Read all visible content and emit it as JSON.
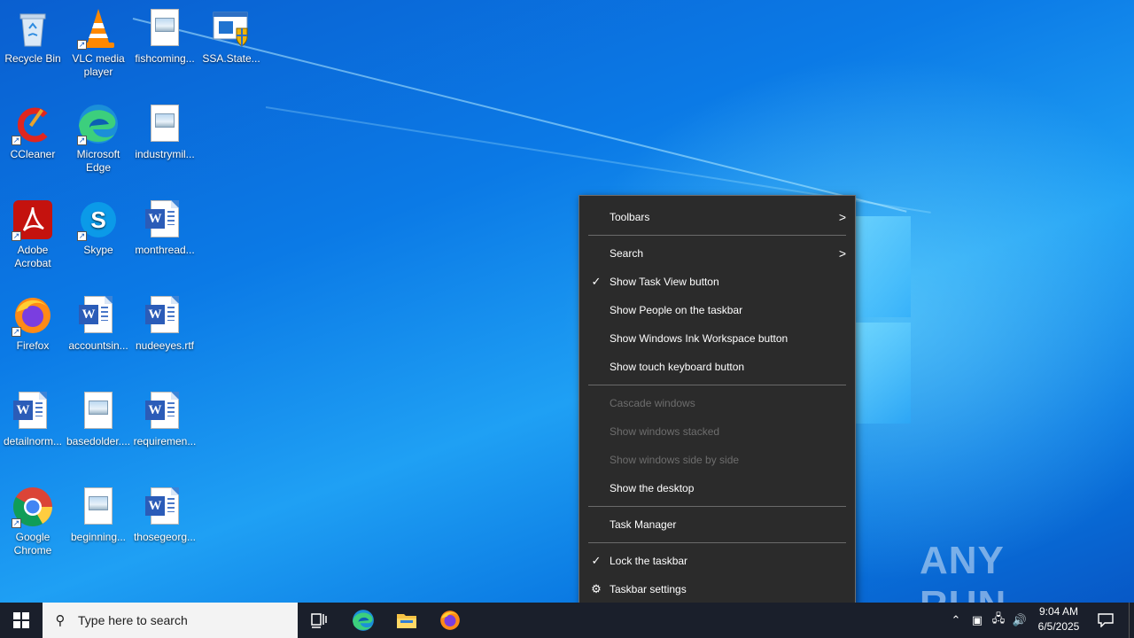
{
  "desktop": {
    "icons": [
      {
        "label": "Recycle Bin"
      },
      {
        "label": "VLC media player"
      },
      {
        "label": "fishcoming..."
      },
      {
        "label": "SSA.State..."
      },
      {
        "label": "CCleaner"
      },
      {
        "label": "Microsoft Edge"
      },
      {
        "label": "industrymil..."
      },
      {
        "label": "Adobe Acrobat"
      },
      {
        "label": "Skype"
      },
      {
        "label": "monthread..."
      },
      {
        "label": "Firefox"
      },
      {
        "label": "accountsin..."
      },
      {
        "label": "nudeeyes.rtf"
      },
      {
        "label": "detailnorm..."
      },
      {
        "label": "basedolder...."
      },
      {
        "label": "requiremen..."
      },
      {
        "label": "Google Chrome"
      },
      {
        "label": "beginning..."
      },
      {
        "label": "thosegeorg..."
      }
    ]
  },
  "context_menu": {
    "toolbars": "Toolbars",
    "search": "Search",
    "show_task_view": "Show Task View button",
    "show_people": "Show People on the taskbar",
    "show_ink": "Show Windows Ink Workspace button",
    "show_touch_keyboard": "Show touch keyboard button",
    "cascade": "Cascade windows",
    "stacked": "Show windows stacked",
    "side_by_side": "Show windows side by side",
    "show_desktop": "Show the desktop",
    "task_manager": "Task Manager",
    "lock_taskbar": "Lock the taskbar",
    "taskbar_settings": "Taskbar settings"
  },
  "taskbar": {
    "search_placeholder": "Type here to search",
    "time": "9:04 AM",
    "date": "6/5/2025"
  },
  "watermark": "ANY RUN",
  "colors": {
    "menu_bg": "#2b2b2b",
    "menu_disabled_text": "#6d6d6d",
    "taskbar_bg": "#1a1f2b",
    "desktop_blue": "#0b7ae6"
  }
}
